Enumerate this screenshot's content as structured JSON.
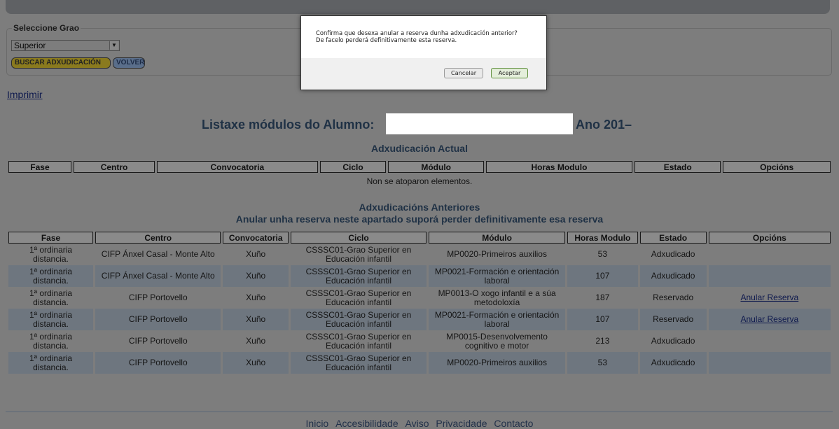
{
  "search": {
    "legend": "Seleccione Grao",
    "selected": "Superior",
    "buscar_label": "BUSCAR ADXUDICACIÓN",
    "volver_label": "VOLVER"
  },
  "imprimir": "Imprimir",
  "heading": {
    "prefix": "Listaxe módulos do Alumno:",
    "suffix": "Ano 201–"
  },
  "actual": {
    "title": "Adxudicación Actual",
    "headers": [
      "Fase",
      "Centro",
      "Convocatoria",
      "Ciclo",
      "Módulo",
      "Horas Modulo",
      "Estado",
      "Opcións"
    ],
    "empty": "Non se atoparon elementos."
  },
  "anteriores": {
    "title": "Adxudicacións Anteriores",
    "subtitle": "Anular unha reserva neste apartado suporá perder definitivamente esa reserva",
    "headers": [
      "Fase",
      "Centro",
      "Convocatoria",
      "Ciclo",
      "Módulo",
      "Horas Modulo",
      "Estado",
      "Opcións"
    ],
    "rows": [
      {
        "fase": "1ª ordinaria distancia.",
        "centro": "CIFP Ánxel Casal - Monte Alto",
        "convocatoria": "Xuño",
        "ciclo": "CSSSC01-Grao Superior en Educación infantil",
        "modulo": "MP0020-Primeiros auxilios",
        "horas": "53",
        "estado": "Adxudicado",
        "opcions": ""
      },
      {
        "fase": "1ª ordinaria distancia.",
        "centro": "CIFP Ánxel Casal - Monte Alto",
        "convocatoria": "Xuño",
        "ciclo": "CSSSC01-Grao Superior en Educación infantil",
        "modulo": "MP0021-Formación e orientación laboral",
        "horas": "107",
        "estado": "Adxudicado",
        "opcions": ""
      },
      {
        "fase": "1ª ordinaria distancia.",
        "centro": "CIFP Portovello",
        "convocatoria": "Xuño",
        "ciclo": "CSSSC01-Grao Superior en Educación infantil",
        "modulo": "MP0013-O xogo infantil e a súa metodoloxía",
        "horas": "187",
        "estado": "Reservado",
        "opcions": "Anular Reserva"
      },
      {
        "fase": "1ª ordinaria distancia.",
        "centro": "CIFP Portovello",
        "convocatoria": "Xuño",
        "ciclo": "CSSSC01-Grao Superior en Educación infantil",
        "modulo": "MP0021-Formación e orientación laboral",
        "horas": "107",
        "estado": "Reservado",
        "opcions": "Anular Reserva"
      },
      {
        "fase": "1ª ordinaria distancia.",
        "centro": "CIFP Portovello",
        "convocatoria": "Xuño",
        "ciclo": "CSSSC01-Grao Superior en Educación infantil",
        "modulo": "MP0015-Desenvolvemento cognitivo e motor",
        "horas": "213",
        "estado": "Adxudicado",
        "opcions": ""
      },
      {
        "fase": "1ª ordinaria distancia.",
        "centro": "CIFP Portovello",
        "convocatoria": "Xuño",
        "ciclo": "CSSSC01-Grao Superior en Educación infantil",
        "modulo": "MP0020-Primeiros auxilios",
        "horas": "53",
        "estado": "Adxudicado",
        "opcions": ""
      }
    ]
  },
  "footer": {
    "links": [
      "Inicio",
      "Accesibilidade",
      "Aviso",
      "Privacidade",
      "Contacto"
    ]
  },
  "dialog": {
    "message_line1": "Confirma que desexa anular a reserva dunha adxudicación anterior?",
    "message_line2": "De facelo perderá definitivamente esta reserva.",
    "cancel_label": "Cancelar",
    "accept_label": "Aceptar"
  }
}
